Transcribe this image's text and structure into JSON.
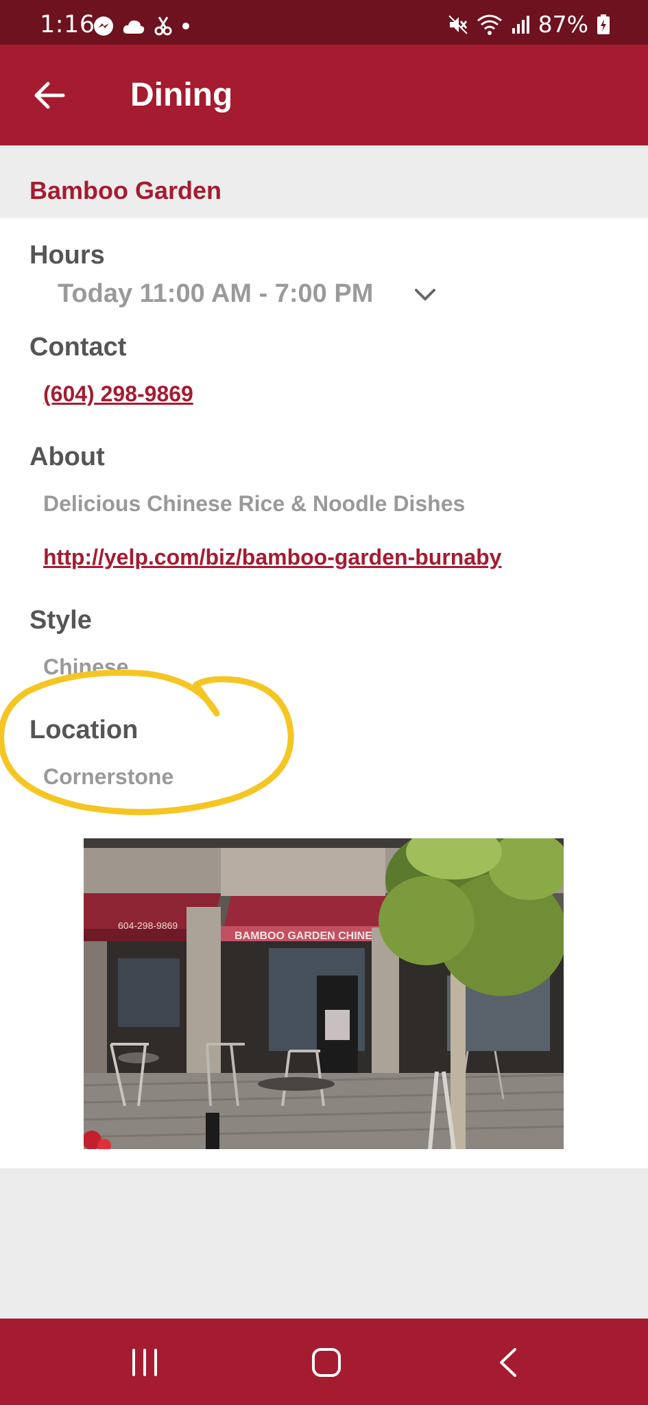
{
  "status_bar": {
    "time": "1:16",
    "battery": "87%"
  },
  "app_bar": {
    "title": "Dining",
    "back_icon": "arrow-left-icon"
  },
  "restaurant": {
    "name": "Bamboo Garden"
  },
  "hours": {
    "heading": "Hours",
    "value": "Today 11:00 AM - 7:00 PM"
  },
  "contact": {
    "heading": "Contact",
    "phone": "(604) 298-9869"
  },
  "about": {
    "heading": "About",
    "description": "Delicious Chinese Rice & Noodle Dishes",
    "url": "http://yelp.com/biz/bamboo-garden-burnaby"
  },
  "style": {
    "heading": "Style",
    "value": "Chinese"
  },
  "location": {
    "heading": "Location",
    "value": "Cornerstone"
  },
  "photo": {
    "sign_text": "BAMBOO GARDEN CHINESE RESTAURANT",
    "awning_phone": "604-298-9869"
  },
  "colors": {
    "brand": "#a51b30",
    "status_bar": "#6e1220",
    "annotation": "#f5c623"
  },
  "nav": {
    "recents_icon": "recent-apps-icon",
    "home_icon": "home-icon",
    "back_icon": "back-chevron-icon"
  }
}
